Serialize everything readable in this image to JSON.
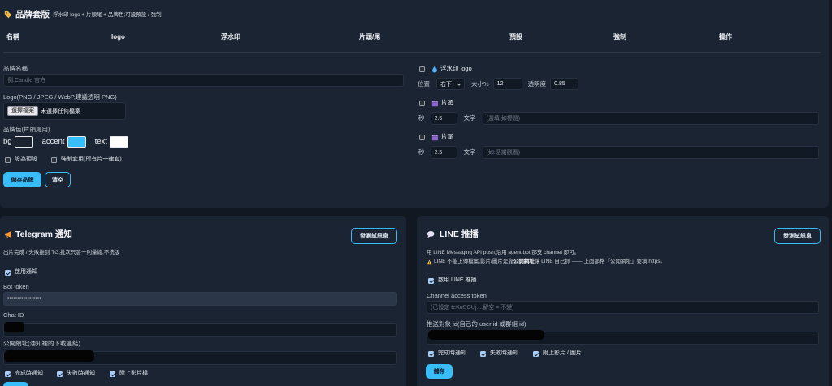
{
  "colors": {
    "accent": "#38bdf8"
  },
  "brand": {
    "icon": "tag-icon",
    "title": "品牌套版",
    "subtitle": "浮水印 logo + 片頭尾 + 品牌色;可設預設 / 強制",
    "table_headers": [
      "名稱",
      "logo",
      "浮水印",
      "片頭/尾",
      "預設",
      "強制",
      "操作"
    ],
    "form": {
      "name_label": "品牌名稱",
      "name_placeholder": "例:Candle 官方",
      "logo_label": "Logo(PNG / JPEG / WebP,建議透明 PNG)",
      "file_button": "選擇檔案",
      "file_status": "未選擇任何檔案",
      "color_label": "品牌色(片頭尾用)",
      "colors": [
        {
          "label": "bg",
          "value": "#1b2230"
        },
        {
          "label": "accent",
          "value": "#38bdf8"
        },
        {
          "label": "text",
          "value": "#ffffff"
        }
      ],
      "set_default_label": "設為預設",
      "set_default_checked": false,
      "force_label": "強制套用(所有片一律套)",
      "force_checked": false,
      "save_label": "儲存品牌",
      "clear_label": "清空"
    },
    "watermark": {
      "icon": "droplet-icon",
      "label": "浮水印 logo",
      "enabled": false,
      "position_label": "位置",
      "position_value": "右下",
      "size_label": "大小%",
      "size_value": "12",
      "opacity_label": "透明度",
      "opacity_value": "0.85"
    },
    "intro": {
      "icon": "clapper-icon",
      "label": "片頭",
      "enabled": false,
      "seconds_label": "秒",
      "seconds_value": "2.5",
      "text_label": "文字",
      "text_placeholder": "(選填,如標題)"
    },
    "outro": {
      "icon": "clapper-icon",
      "label": "片尾",
      "enabled": false,
      "seconds_label": "秒",
      "seconds_value": "2.5",
      "text_label": "文字",
      "text_placeholder": "(如:感謝觀看)"
    }
  },
  "telegram": {
    "icon": "megaphone-icon",
    "title": "Telegram 通知",
    "test_button": "發測試訊息",
    "description": "出片完成 / 失敗推到 TG;批次只發一則彙總,不洗版",
    "enable_label": "啟用通知",
    "enabled": true,
    "bot_token_label": "Bot token",
    "bot_token_value": "•••••••••••••••••",
    "chat_id_label": "Chat ID",
    "public_url_label": "公開網址(通知裡的下載連結)",
    "options": [
      {
        "label": "完成時通知",
        "checked": true
      },
      {
        "label": "失敗時通知",
        "checked": true
      },
      {
        "label": "附上影片檔",
        "checked": true
      }
    ]
  },
  "line": {
    "icon": "speech-bubble-icon",
    "title": "LINE 推播",
    "test_button": "發測試訊息",
    "description": "用 LINE Messaging API push;沿用 agent bot 那支 channel 即可。",
    "warning": {
      "icon": "warning-icon",
      "before": "LINE 不能上傳檔案,影片/圖片是靠",
      "bold": "公開網址",
      "after": "讓 LINE 自己抓 —— 上面那格「公開網址」要填 https。"
    },
    "enable_label": "啟用 LINE 推播",
    "enabled": true,
    "token_label": "Channel access token",
    "token_placeholder": "(已設定 teKuSGUj....留空 = 不變)",
    "target_label": "推送對象 id(自己的 user id 或群組 id)",
    "options": [
      {
        "label": "完成時通知",
        "checked": true
      },
      {
        "label": "失敗時通知",
        "checked": true
      },
      {
        "label": "附上影片 / 圖片",
        "checked": true
      }
    ],
    "save_label": "儲存"
  }
}
